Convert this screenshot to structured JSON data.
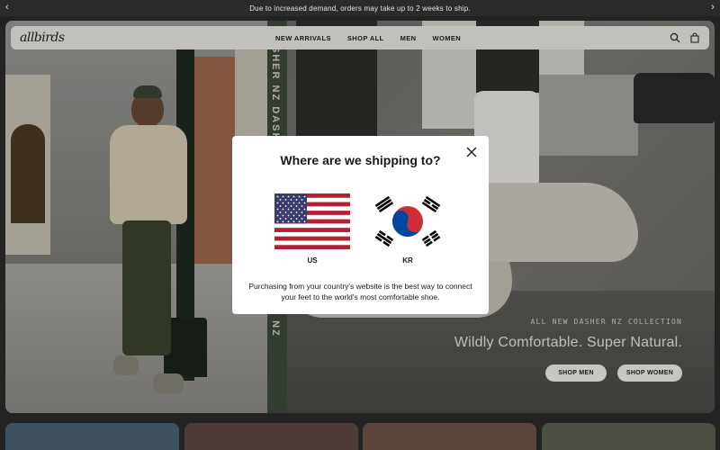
{
  "announcement": {
    "text": "Due to increased demand, orders may take up to 2 weeks to ship.",
    "prev_arrow": "‹",
    "next_arrow": "›"
  },
  "nav": {
    "logo": "allbirds",
    "links": [
      "NEW ARRIVALS",
      "SHOP ALL",
      "MEN",
      "WOMEN"
    ],
    "icons": [
      "search-icon",
      "cart-icon"
    ]
  },
  "hero": {
    "strip_text": "DASHER NZ DASHER NZ DASHER NZ DASHER NZ",
    "kicker": "ALL NEW DASHER NZ COLLECTION",
    "title": "Wildly Comfortable. Super Natural.",
    "buttons": {
      "shop_men": "SHOP MEN",
      "shop_women": "SHOP WOMEN"
    }
  },
  "modal": {
    "title": "Where are we shipping to?",
    "options": [
      {
        "code": "US",
        "flag": "us-flag-icon"
      },
      {
        "code": "KR",
        "flag": "kr-flag-icon"
      }
    ],
    "description": "Purchasing from your country's website is the best way to connect your feet to the world's most comfortable shoe."
  },
  "colors": {
    "announcement_bg": "#2b2b2b",
    "nav_bg": "#ecebe6",
    "modal_bg": "#ffffff",
    "card_colors": [
      "#4f6576",
      "#5e4a44",
      "#6e5348",
      "#5c6052"
    ]
  }
}
